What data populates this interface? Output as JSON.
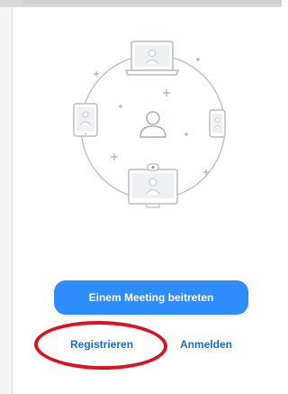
{
  "welcome": {
    "join_button_label": "Einem Meeting beitreten",
    "register_link_label": "Registrieren",
    "signin_link_label": "Anmelden"
  },
  "colors": {
    "accent": "#2d8cff",
    "link": "#1a6fd6",
    "highlight": "#e0101c",
    "illustration_stroke": "#b9bcc4"
  },
  "illustration": {
    "icon": "devices-connected-illustration"
  },
  "annotation": {
    "icon": "red-ellipse-highlight"
  }
}
